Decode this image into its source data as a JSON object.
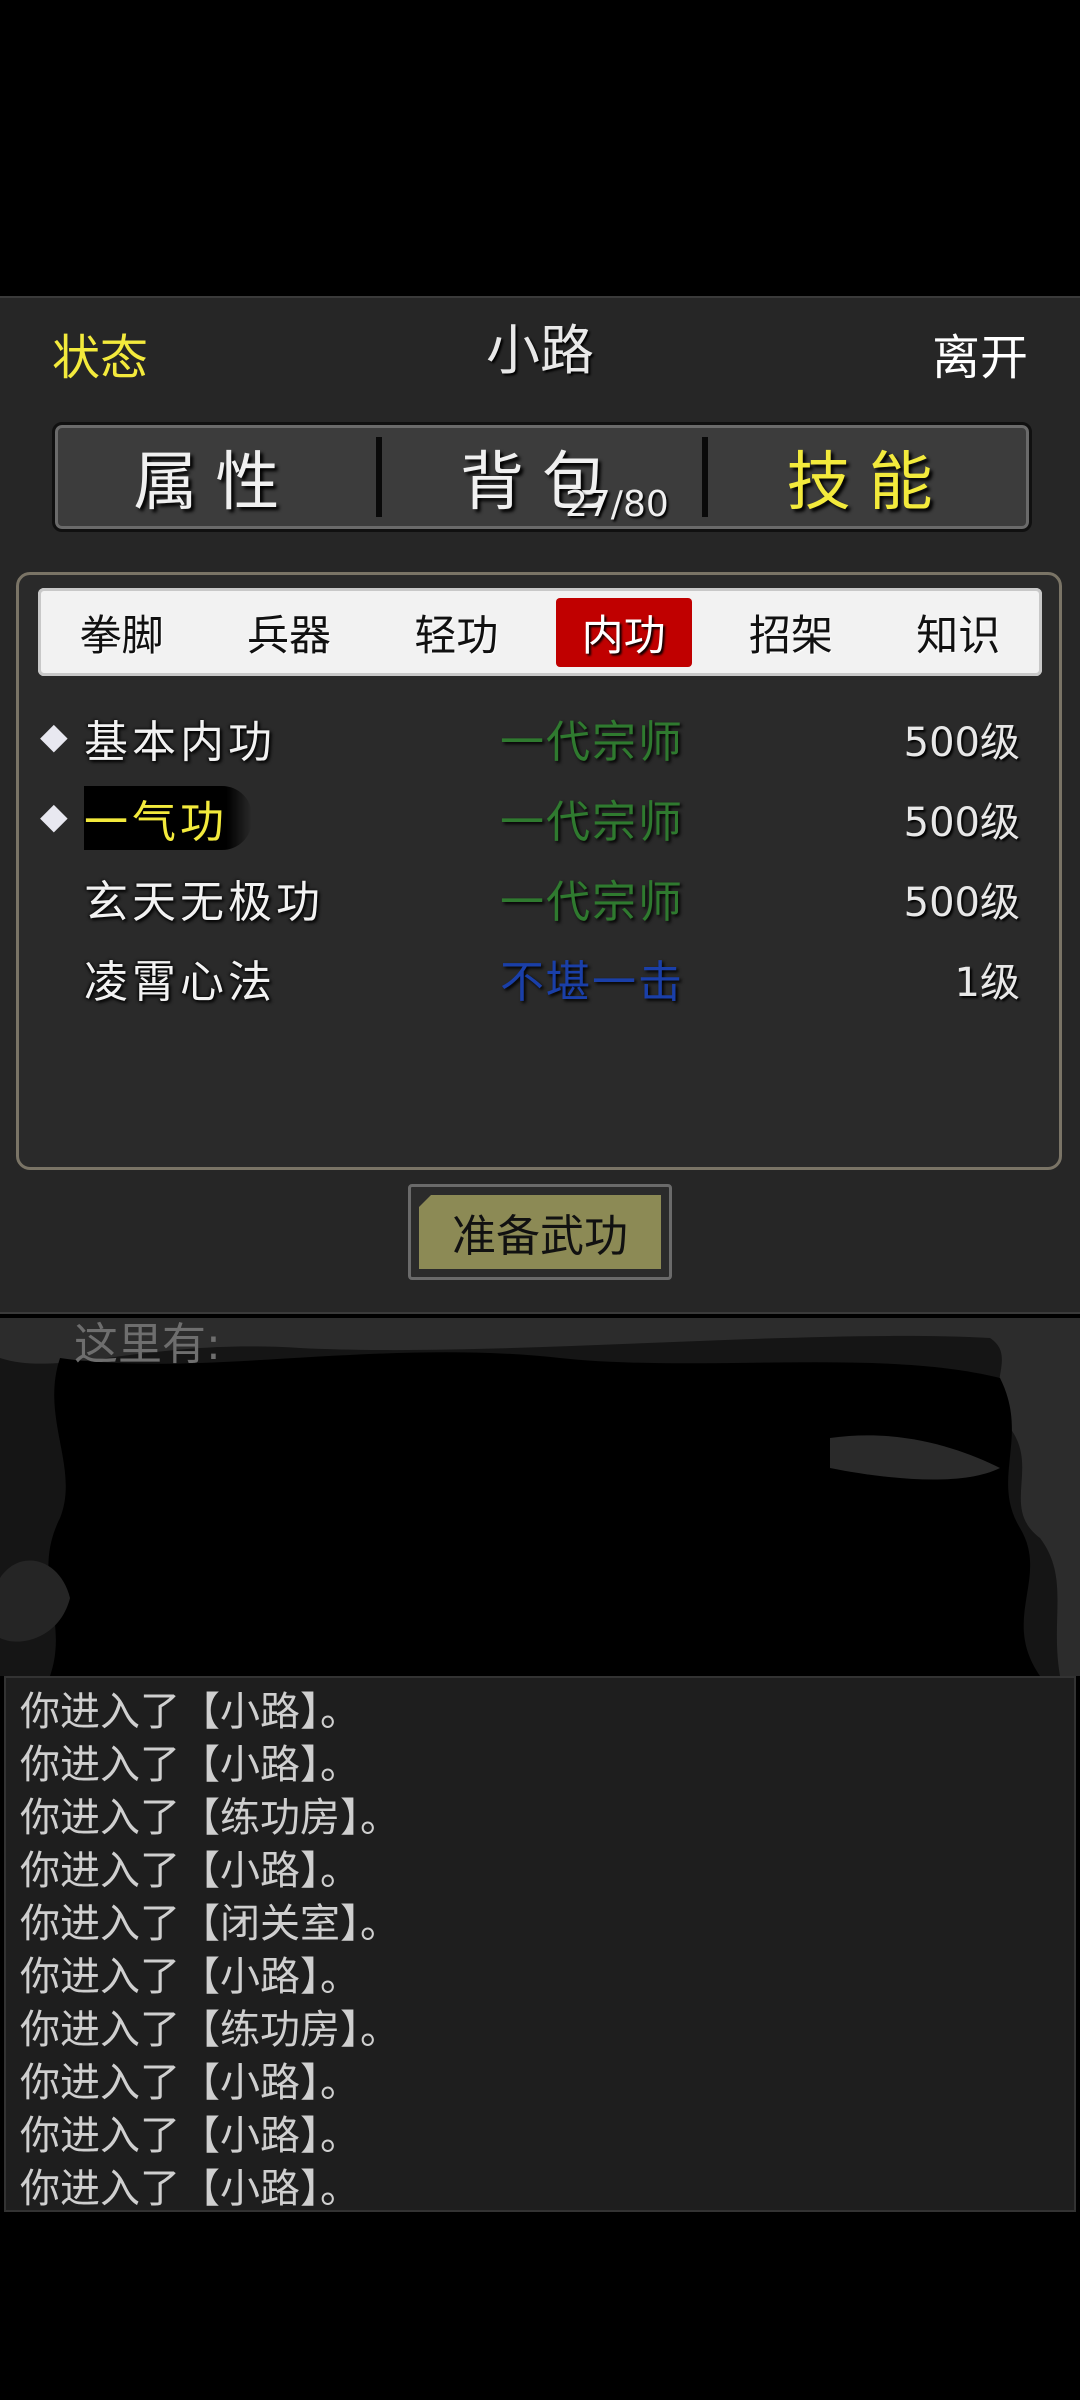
{
  "header": {
    "status_label": "状态",
    "location_title": "小路",
    "leave_label": "离开"
  },
  "main_tabs": [
    {
      "label": "属性",
      "active": false
    },
    {
      "label": "背包",
      "active": false,
      "count": "27/80"
    },
    {
      "label": "技能",
      "active": true
    }
  ],
  "sub_tabs": [
    {
      "label": "拳脚",
      "active": false
    },
    {
      "label": "兵器",
      "active": false
    },
    {
      "label": "轻功",
      "active": false
    },
    {
      "label": "内功",
      "active": true
    },
    {
      "label": "招架",
      "active": false
    },
    {
      "label": "知识",
      "active": false
    }
  ],
  "skills": [
    {
      "marker": "◆",
      "name": "基本内功",
      "rank": "一代宗师",
      "rank_color": "#2f7a2f",
      "level": "500级"
    },
    {
      "marker": "◆",
      "name": "一气功",
      "rank": "一代宗师",
      "rank_color": "#2f7a2f",
      "level": "500级",
      "selected": true
    },
    {
      "marker": "",
      "name": "玄天无极功",
      "rank": "一代宗师",
      "rank_color": "#2f7a2f",
      "level": "500级"
    },
    {
      "marker": "",
      "name": "凌霄心法",
      "rank": "不堪一击",
      "rank_color": "#1a3fa8",
      "level": "1级"
    }
  ],
  "prepare_button": "准备武功",
  "scene": {
    "label": "这里有:"
  },
  "log": [
    "你进入了【小路】。",
    "你进入了【小路】。",
    "你进入了【练功房】。",
    "你进入了【小路】。",
    "你进入了【闭关室】。",
    "你进入了【小路】。",
    "你进入了【练功房】。",
    "你进入了【小路】。",
    "你进入了【小路】。",
    "你进入了【小路】。"
  ],
  "colors": {
    "highlight_yellow": "#f3ea3c",
    "active_tab_red": "#c00000",
    "panel_bg": "#262626"
  }
}
